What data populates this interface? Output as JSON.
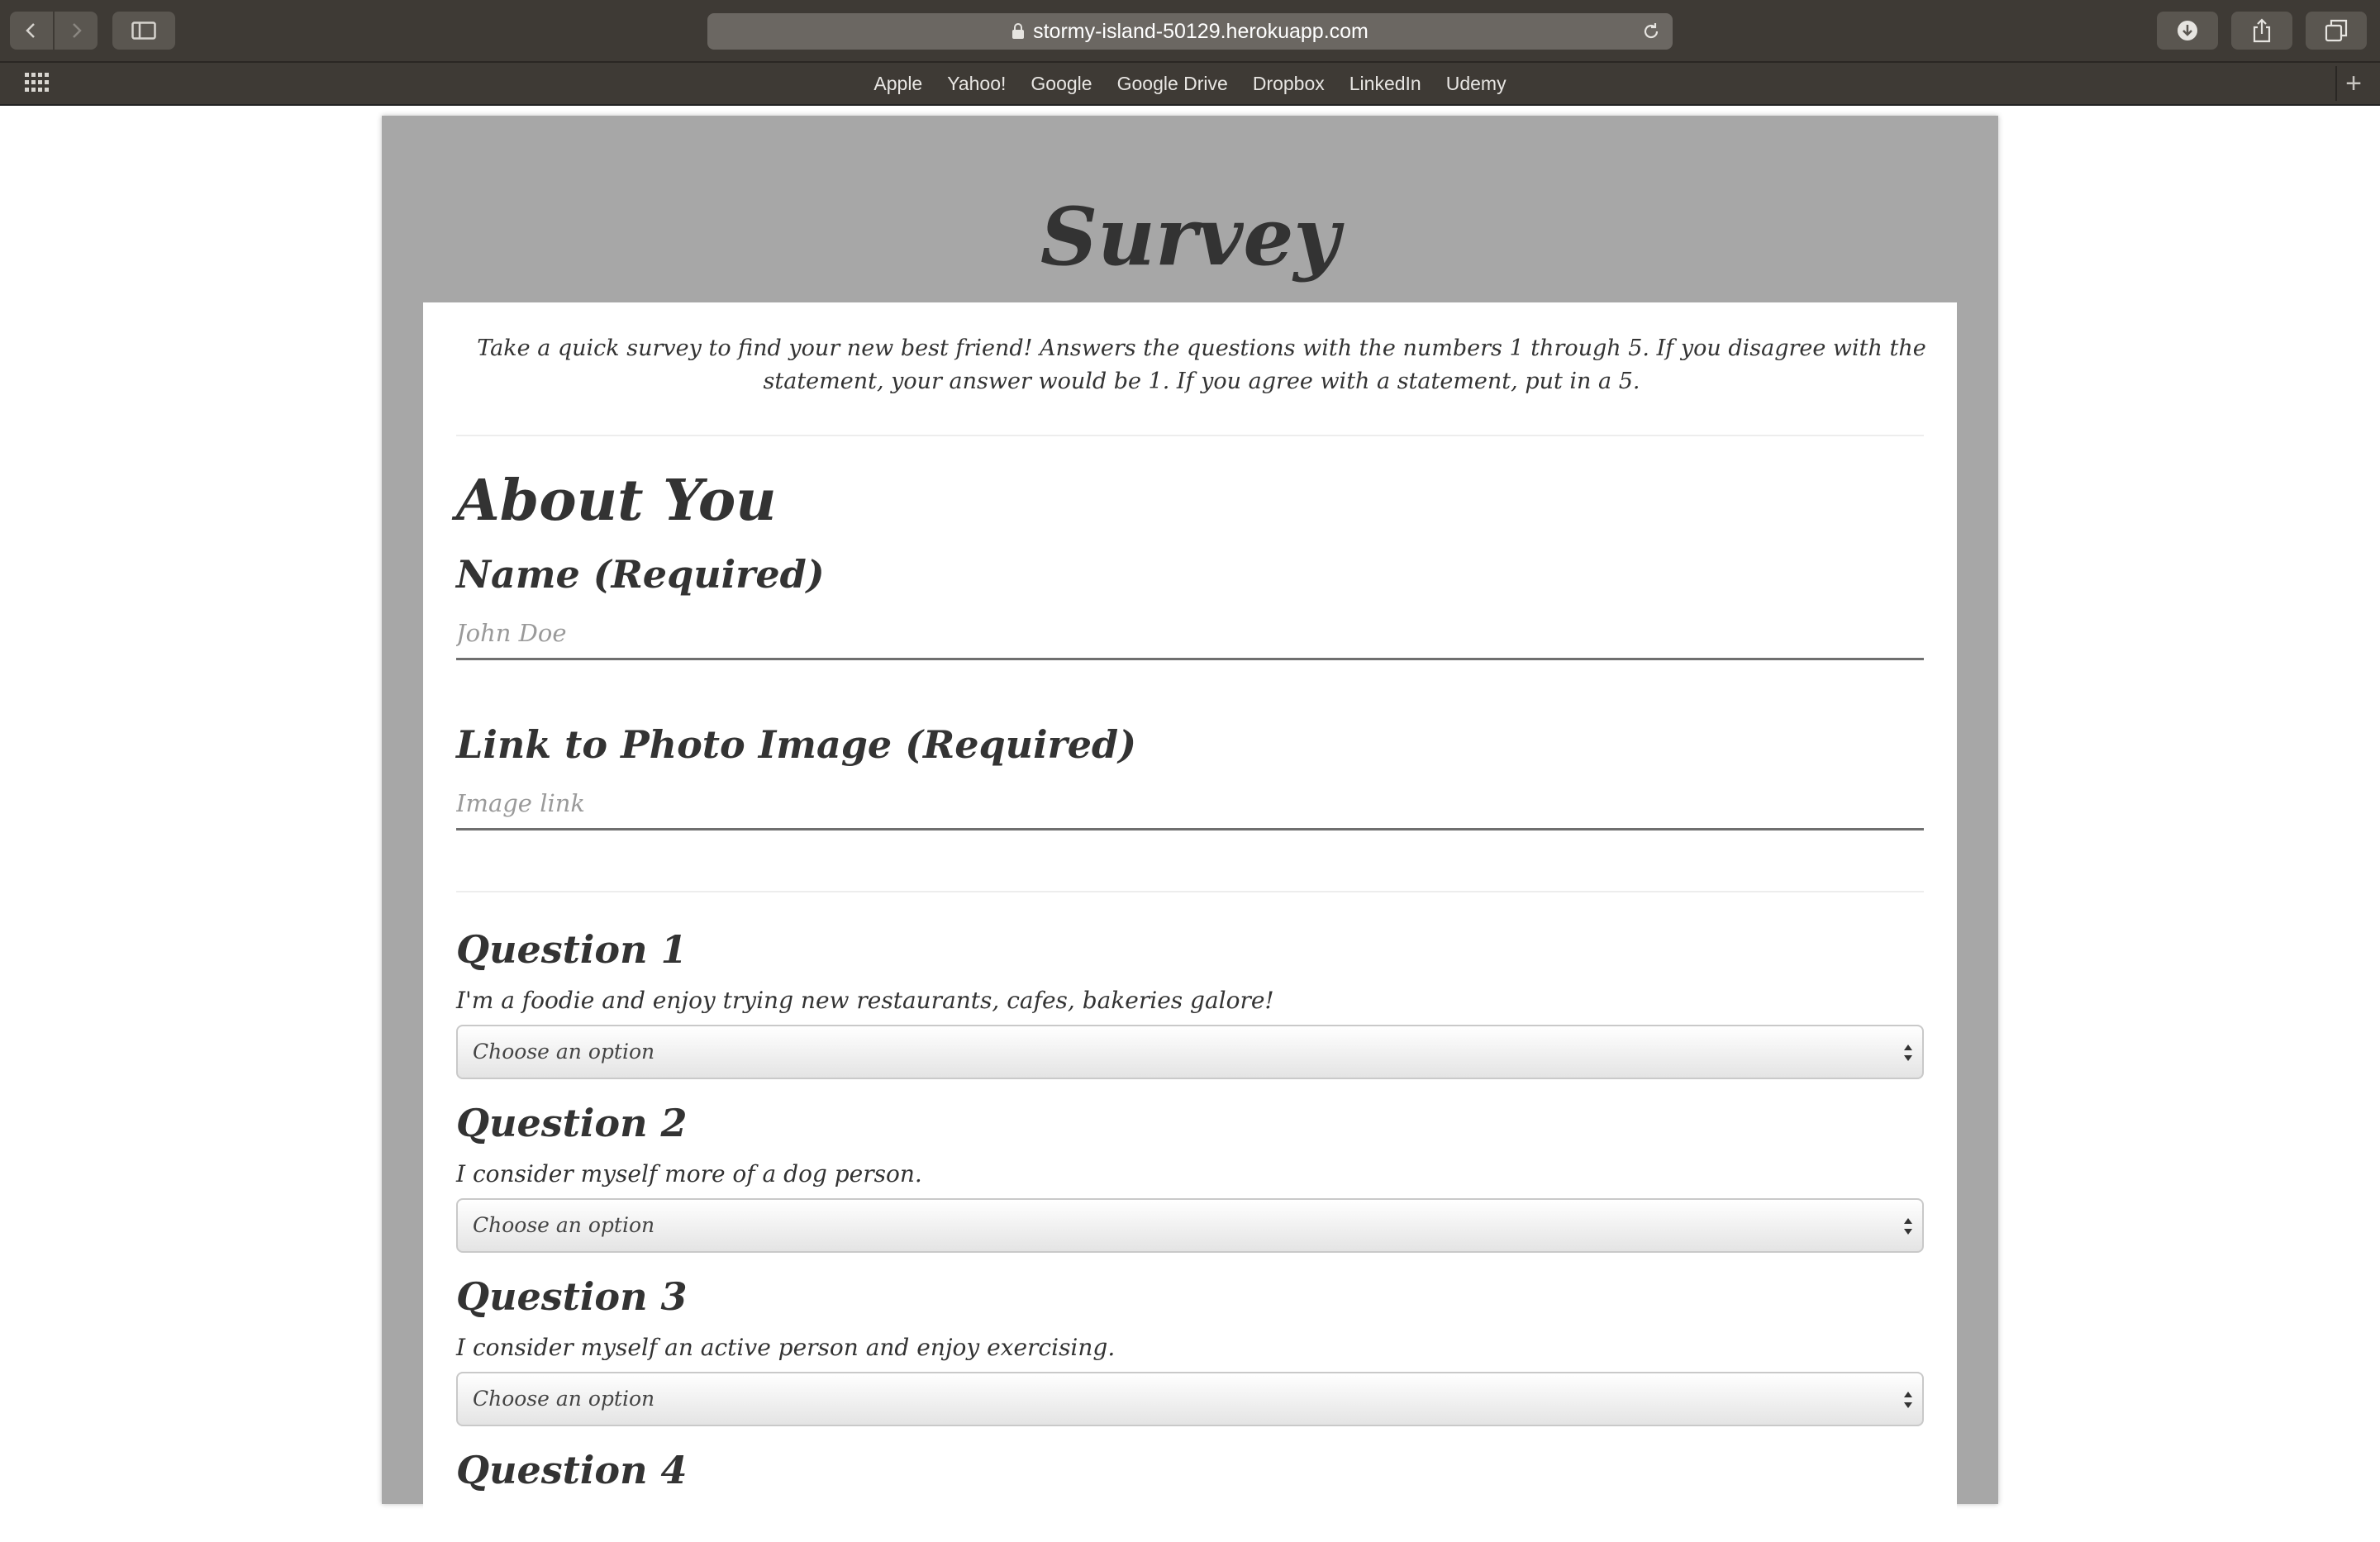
{
  "browser": {
    "url": "stormy-island-50129.herokuapp.com",
    "bookmarks": [
      "Apple",
      "Yahoo!",
      "Google",
      "Google Drive",
      "Dropbox",
      "LinkedIn",
      "Udemy"
    ],
    "new_tab_symbol": "+"
  },
  "page": {
    "title": "Survey",
    "intro": "Take a quick survey to find your new best friend! Answers the questions with the numbers 1 through 5. If you disagree with the statement, your answer would be 1. If you agree with a statement, put in a 5.",
    "about_heading": "About You",
    "name_label": "Name (Required)",
    "name_placeholder": "John Doe",
    "name_value": "",
    "photo_label": "Link to Photo Image (Required)",
    "photo_placeholder": "Image link",
    "photo_value": "",
    "questions": [
      {
        "heading": "Question 1",
        "text": "I'm a foodie and enjoy trying new restaurants, cafes, bakeries galore!",
        "selected": "Choose an option"
      },
      {
        "heading": "Question 2",
        "text": "I consider myself more of a dog person.",
        "selected": "Choose an option"
      },
      {
        "heading": "Question 3",
        "text": "I consider myself an active person and enjoy exercising.",
        "selected": "Choose an option"
      },
      {
        "heading": "Question 4"
      }
    ]
  }
}
